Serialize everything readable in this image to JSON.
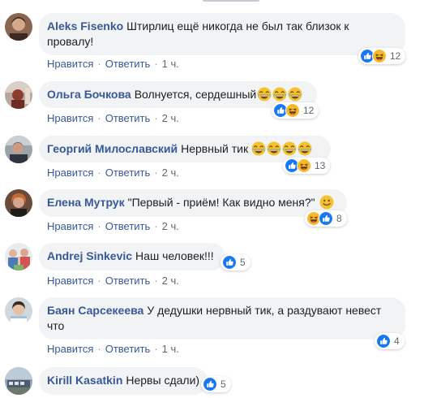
{
  "actions": {
    "like": "Нравится",
    "reply": "Ответить"
  },
  "comments": [
    {
      "author": "Aleks Fisenko",
      "text": "Штирлиц ещё никогда не был так близок к провалу!",
      "time": "1 ч.",
      "reaction_count": "12"
    },
    {
      "author": "Ольга Бочкова",
      "text": "Волнуется, сердешный",
      "time": "2 ч.",
      "reaction_count": "12"
    },
    {
      "author": "Георгий Милославский",
      "text": "Нервный тик",
      "time": "2 ч.",
      "reaction_count": "13"
    },
    {
      "author": "Елена Мутрук",
      "text": "\"Первый - приём! Как видно меня?\"",
      "time": "2 ч.",
      "reaction_count": "8"
    },
    {
      "author": "Andrej Sinkevic",
      "text": "Наш человек!!!",
      "time": "2 ч.",
      "reaction_count": "5"
    },
    {
      "author": "Баян Сарсекеева",
      "text": "У дедушки нервный тик, а раздувают невест что",
      "time": "1 ч.",
      "reaction_count": "4"
    },
    {
      "author": "Kirill Kasatkin",
      "text": "Нервы сдали)",
      "time": "",
      "reaction_count": "5"
    }
  ],
  "colors": {
    "author": "#385898",
    "bubble": "#f2f3f5",
    "like_blue": "#1877f2",
    "haha_yellow": "#f7b928"
  },
  "icons": {
    "like": "like-reaction-icon",
    "haha": "haha-reaction-icon",
    "laughing_emoji": "laughing-emoji-icon",
    "smile_emoji": "smile-emoji-icon"
  }
}
